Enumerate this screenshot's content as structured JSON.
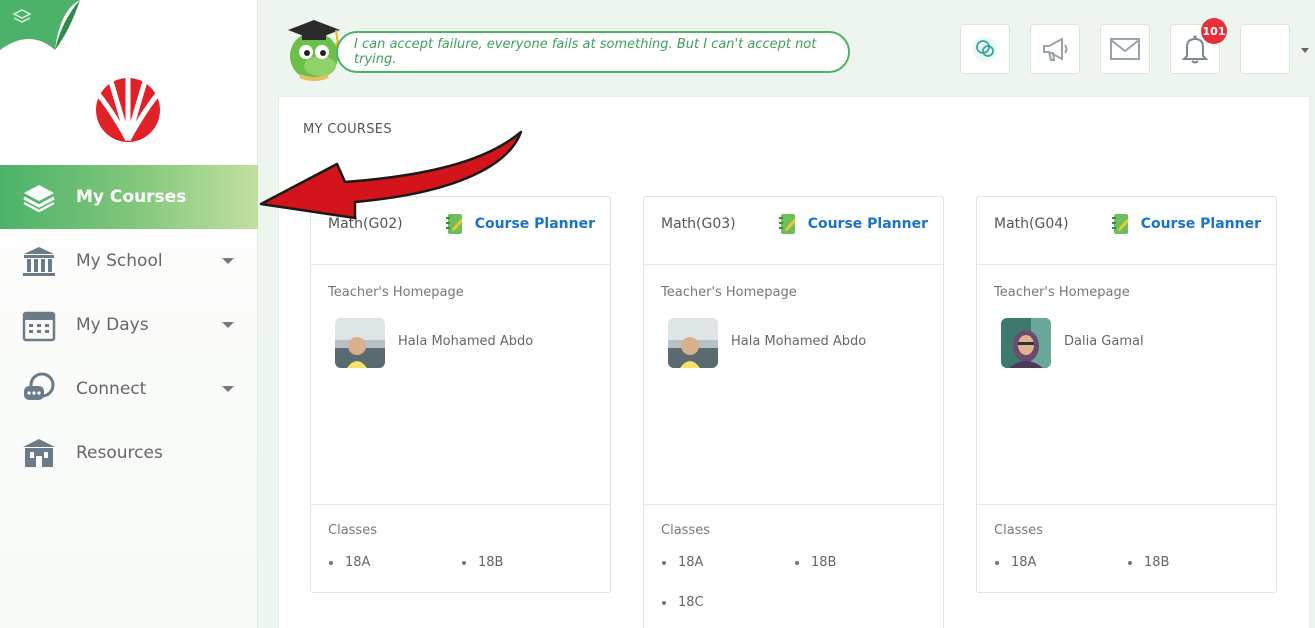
{
  "sidebar": {
    "items": [
      {
        "label": "My Courses",
        "icon": "layers-icon",
        "active": true,
        "has_caret": false
      },
      {
        "label": "My School",
        "icon": "school-building-icon",
        "active": false,
        "has_caret": true
      },
      {
        "label": "My Days",
        "icon": "calendar-icon",
        "active": false,
        "has_caret": true
      },
      {
        "label": "Connect",
        "icon": "chat-icon",
        "active": false,
        "has_caret": true
      },
      {
        "label": "Resources",
        "icon": "library-icon",
        "active": false,
        "has_caret": false
      }
    ]
  },
  "header": {
    "quote": "I can accept failure, everyone fails at something. But I can't accept not trying.",
    "notification_count": "101",
    "buttons": [
      "chat-support-icon",
      "megaphone-icon",
      "mail-icon",
      "bell-icon",
      "profile-avatar"
    ]
  },
  "main": {
    "title": "MY COURSES",
    "courses": [
      {
        "name": "Math(G02)",
        "planner_label": "Course Planner",
        "teacher_title": "Teacher's Homepage",
        "teacher": "Hala Mohamed Abdo",
        "classes_title": "Classes",
        "classes": [
          "18A",
          "18B"
        ]
      },
      {
        "name": "Math(G03)",
        "planner_label": "Course Planner",
        "teacher_title": "Teacher's Homepage",
        "teacher": "Hala Mohamed Abdo",
        "classes_title": "Classes",
        "classes": [
          "18A",
          "18B",
          "18C"
        ]
      },
      {
        "name": "Math(G04)",
        "planner_label": "Course Planner",
        "teacher_title": "Teacher's Homepage",
        "teacher": "Dalia Gamal",
        "classes_title": "Classes",
        "classes": [
          "18A",
          "18B"
        ]
      }
    ]
  },
  "colors": {
    "accent_green": "#4cb26a",
    "link_blue": "#1a73c9",
    "badge_red": "#e5303a",
    "arrow_red": "#d4141b"
  }
}
